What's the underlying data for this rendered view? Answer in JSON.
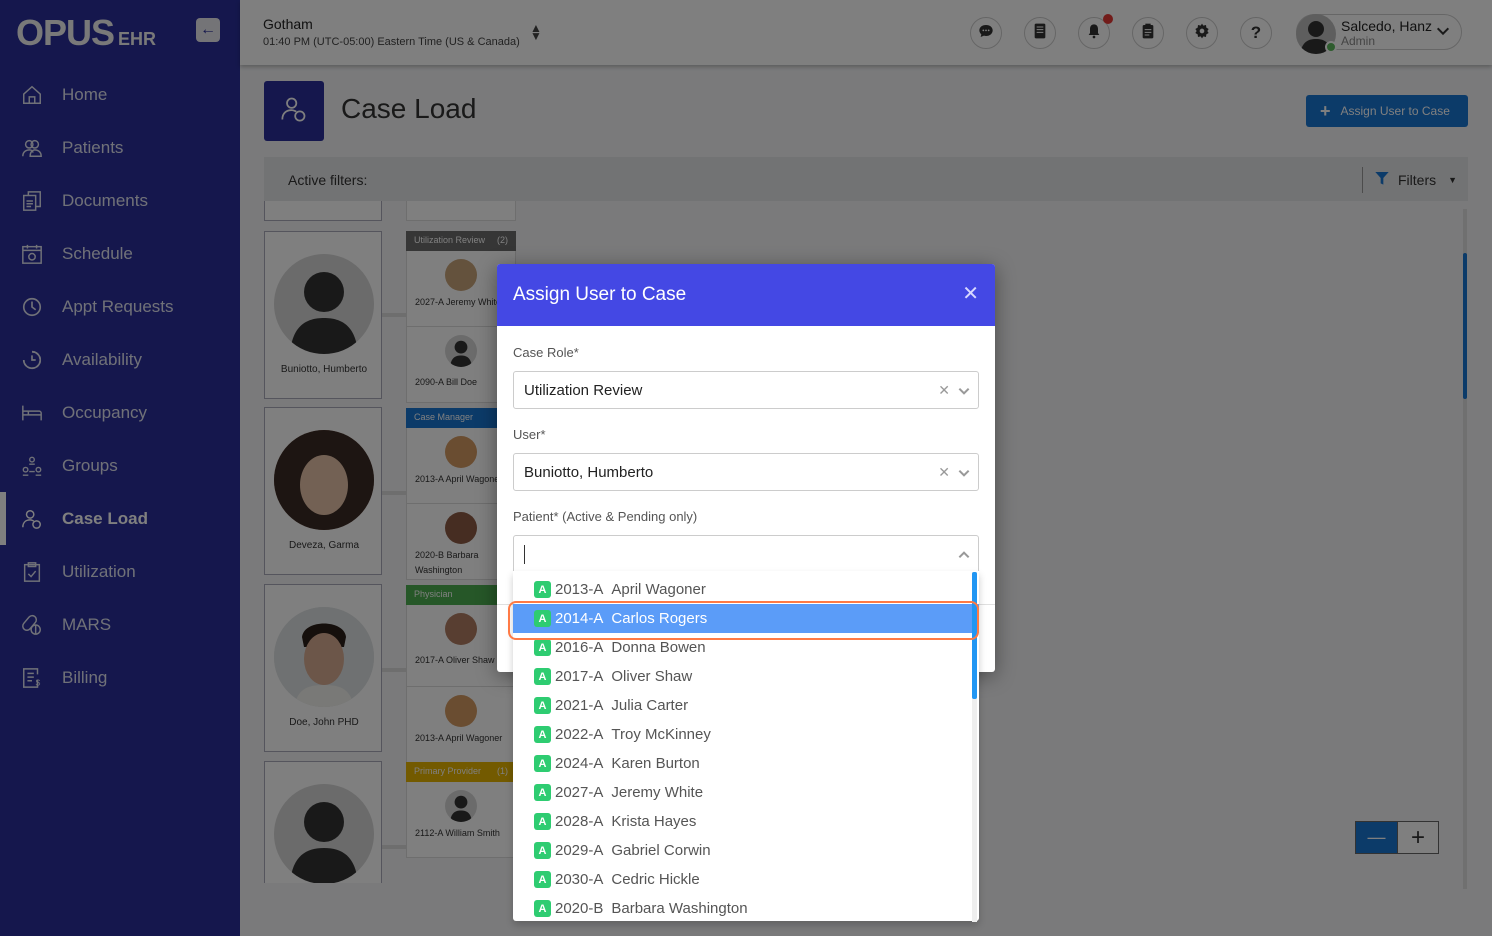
{
  "app": {
    "logo_main": "OPUS",
    "logo_sub": "EHR"
  },
  "sidebar": {
    "items": [
      {
        "label": "Home",
        "icon": "home-icon"
      },
      {
        "label": "Patients",
        "icon": "patients-icon"
      },
      {
        "label": "Documents",
        "icon": "documents-icon"
      },
      {
        "label": "Schedule",
        "icon": "calendar-icon"
      },
      {
        "label": "Appt Requests",
        "icon": "clock-icon"
      },
      {
        "label": "Availability",
        "icon": "availability-icon"
      },
      {
        "label": "Occupancy",
        "icon": "bed-icon"
      },
      {
        "label": "Groups",
        "icon": "groups-icon"
      },
      {
        "label": "Case Load",
        "icon": "caseload-icon",
        "active": true
      },
      {
        "label": "Utilization",
        "icon": "clipboard-check-icon"
      },
      {
        "label": "MARS",
        "icon": "pills-icon"
      },
      {
        "label": "Billing",
        "icon": "billing-icon"
      }
    ]
  },
  "topbar": {
    "location": "Gotham",
    "time": "01:40 PM (UTC-05:00) Eastern Time (US & Canada)",
    "icons": [
      "chat-icon",
      "book-icon",
      "bell-icon",
      "clipboard-icon",
      "gear-icon",
      "help-icon"
    ],
    "user_name": "Salcedo, Hanz",
    "user_role": "Admin",
    "colors": {
      "notification": "#e53935",
      "online": "#5cb85c"
    }
  },
  "page": {
    "title": "Case Load",
    "assign_button": "Assign User to Case",
    "active_filters_label": "Active filters:",
    "filters_button": "Filters"
  },
  "board": {
    "staff": [
      {
        "name": "Buniotto, Humberto",
        "avatar": "placeholder"
      },
      {
        "name": "Deveza, Garma",
        "avatar": "photo"
      },
      {
        "name": "Doe, John PHD",
        "avatar": "photo"
      },
      {
        "name": "",
        "avatar": "placeholder"
      }
    ],
    "roles": [
      {
        "name": "Utilization Review",
        "count": "(2)",
        "color": "#6d6d6d",
        "patients": [
          "2027-A Jeremy White",
          "2090-A Bill Doe"
        ]
      },
      {
        "name": "Case Manager",
        "count": "",
        "color": "#1976d2",
        "patients": [
          "2013-A April Wagoner",
          "2020-B Barbara Washington"
        ]
      },
      {
        "name": "Physician",
        "count": "",
        "color": "#4caf50",
        "patients": [
          "2017-A Oliver Shaw",
          "2013-A April Wagoner"
        ]
      },
      {
        "name": "Primary Provider",
        "count": "(1)",
        "color": "#e6b400",
        "patients": [
          "2112-A William Smith"
        ]
      }
    ],
    "zoom_out": "—",
    "zoom_in": "+"
  },
  "modal": {
    "title": "Assign User to Case",
    "case_role_label": "Case Role*",
    "case_role_value": "Utilization Review",
    "user_label": "User*",
    "user_value": "Buniotto, Humberto",
    "patient_label": "Patient* (Active & Pending only)",
    "patient_value": "",
    "header_color": "#4448e4"
  },
  "dropdown": {
    "badge": "A",
    "selected_index": 1,
    "items": [
      {
        "code": "2013-A",
        "name": "April Wagoner"
      },
      {
        "code": "2014-A",
        "name": "Carlos Rogers"
      },
      {
        "code": "2016-A",
        "name": "Donna Bowen"
      },
      {
        "code": "2017-A",
        "name": "Oliver Shaw"
      },
      {
        "code": "2021-A",
        "name": "Julia Carter"
      },
      {
        "code": "2022-A",
        "name": "Troy McKinney"
      },
      {
        "code": "2024-A",
        "name": "Karen Burton"
      },
      {
        "code": "2027-A",
        "name": "Jeremy White"
      },
      {
        "code": "2028-A",
        "name": "Krista Hayes"
      },
      {
        "code": "2029-A",
        "name": "Gabriel Corwin"
      },
      {
        "code": "2030-A",
        "name": "Cedric Hickle"
      },
      {
        "code": "2020-B",
        "name": "Barbara Washington"
      }
    ]
  }
}
